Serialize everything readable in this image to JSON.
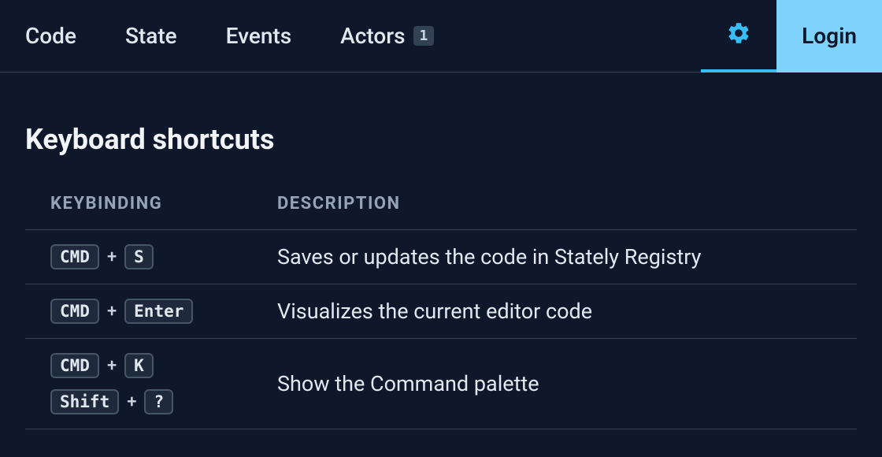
{
  "header": {
    "tabs": [
      {
        "label": "Code"
      },
      {
        "label": "State"
      },
      {
        "label": "Events"
      },
      {
        "label": "Actors",
        "badge": "1"
      }
    ],
    "login_label": "Login"
  },
  "page": {
    "title": "Keyboard shortcuts",
    "columns": {
      "keybinding": "Keybinding",
      "description": "Description"
    },
    "shortcuts": [
      {
        "combos": [
          [
            "CMD",
            "S"
          ]
        ],
        "description": "Saves or updates the code in Stately Registry"
      },
      {
        "combos": [
          [
            "CMD",
            "Enter"
          ]
        ],
        "description": "Visualizes the current editor code"
      },
      {
        "combos": [
          [
            "CMD",
            "K"
          ],
          [
            "Shift",
            "?"
          ]
        ],
        "description": "Show the Command palette"
      }
    ],
    "plus": "+"
  }
}
